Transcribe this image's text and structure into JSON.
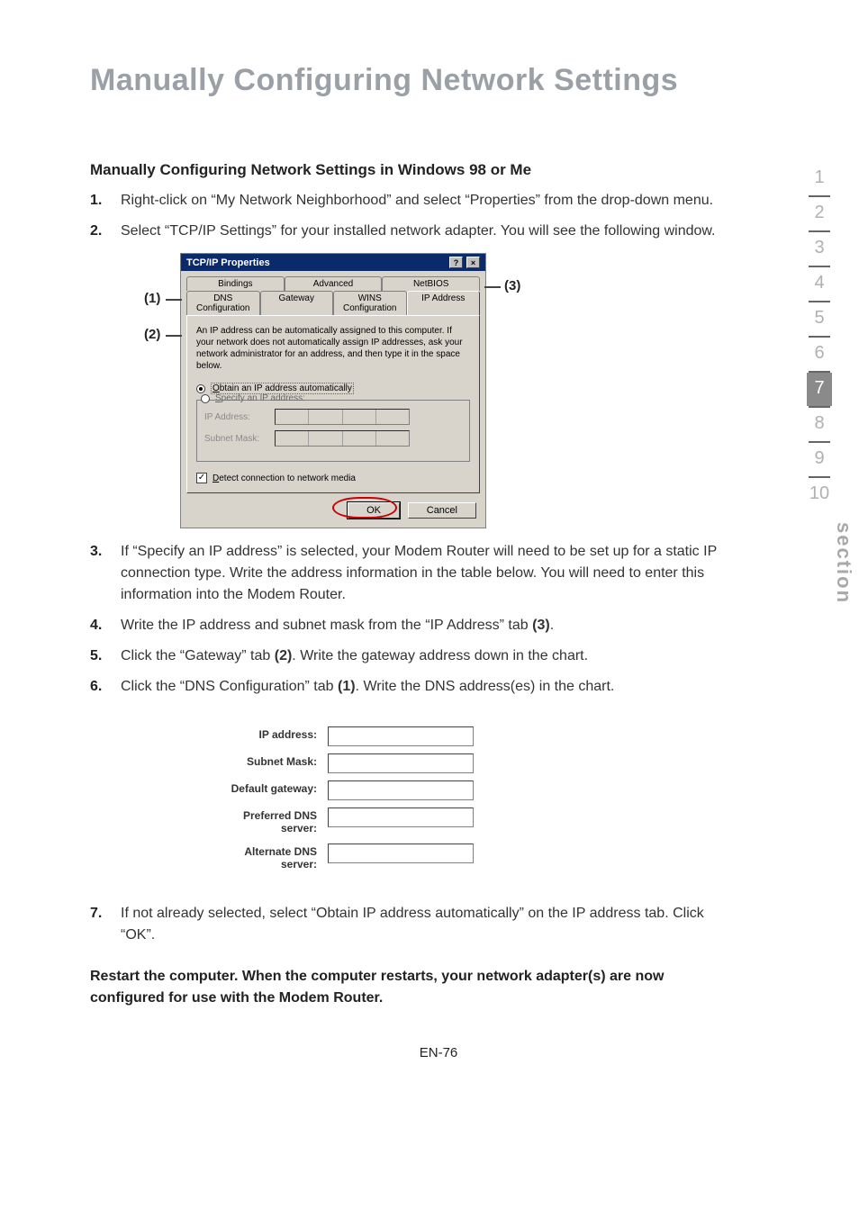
{
  "page": {
    "title": "Manually Configuring Network Settings",
    "number": "EN-76",
    "section_label": "section"
  },
  "side_index": [
    "1",
    "2",
    "3",
    "4",
    "5",
    "6",
    "7",
    "8",
    "9",
    "10"
  ],
  "side_index_active": "7",
  "subheading": "Manually Configuring Network Settings in Windows 98 or Me",
  "steps_part1": [
    {
      "n": "1.",
      "t": "Right-click on “My Network Neighborhood” and select “Properties” from the drop-down menu."
    },
    {
      "n": "2.",
      "t": "Select “TCP/IP Settings” for your installed network adapter. You will see the following window."
    }
  ],
  "screenshot": {
    "window_title": "TCP/IP Properties",
    "close_q": "?",
    "close_x": "×",
    "tabs_row1": [
      "Bindings",
      "Advanced",
      "NetBIOS"
    ],
    "tabs_row2": [
      "DNS Configuration",
      "Gateway",
      "WINS Configuration",
      "IP Address"
    ],
    "active_tab": "IP Address",
    "blurb": "An IP address can be automatically assigned to this computer. If your network does not automatically assign IP addresses, ask your network administrator for an address, and then type it in the space below.",
    "radio_auto_pre": "O",
    "radio_auto_text": "btain an IP address automatically",
    "radio_spec_pre": "S",
    "radio_spec_text": "pecify an IP address:",
    "field_ip": "IP Address:",
    "field_subnet": "Subnet Mask:",
    "checkbox_pre": "D",
    "checkbox_text": "etect connection to network media",
    "btn_ok": "OK",
    "btn_cancel": "Cancel",
    "callouts": {
      "c1": "(1)",
      "c2": "(2)",
      "c3": "(3)"
    }
  },
  "steps_part2": [
    {
      "n": "3.",
      "t": "If “Specify an IP address” is selected, your Modem Router will need to be set up for a static IP connection type. Write the address information in the table below. You will need to enter this information into the Modem Router."
    },
    {
      "n": "4.",
      "ttail_bold": "(3)",
      "ttail_after": ".",
      "t": "Write the IP address and subnet mask from the “IP Address” tab "
    },
    {
      "n": "5.",
      "tmid_bold": "(2)",
      "t_before": "Click the “Gateway” tab ",
      "t_after": ". Write the gateway address down in the chart."
    },
    {
      "n": "6.",
      "tmid_bold": "(1)",
      "t_before": "Click the “DNS Configuration” tab ",
      "t_after": ". Write the DNS address(es) in the chart."
    }
  ],
  "table_rows": [
    "IP address:",
    "Subnet Mask:",
    "Default gateway:",
    "Preferred DNS server:",
    "Alternate DNS server:"
  ],
  "steps_part3": [
    {
      "n": "7.",
      "t": "If not already selected, select “Obtain IP address automatically” on the IP address tab. Click “OK”."
    }
  ],
  "footer_note": "Restart the computer. When the computer restarts, your network adapter(s) are now configured for use with the Modem Router."
}
